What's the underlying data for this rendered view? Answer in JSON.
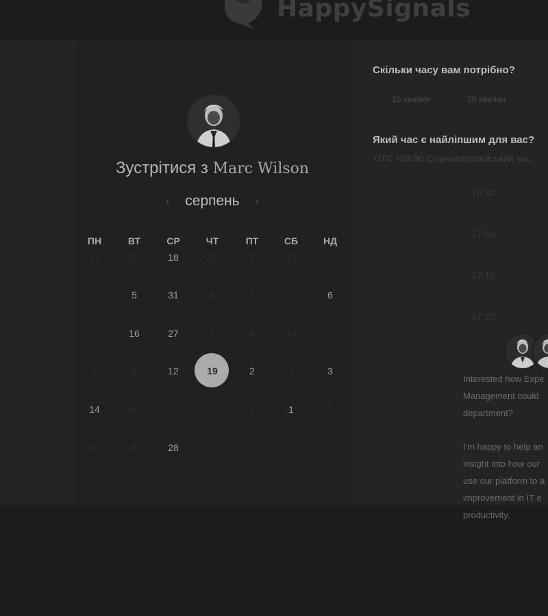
{
  "brand": {
    "name": "HappySignals",
    "logo_icon": "speech-bubble-heart-icon"
  },
  "host": {
    "heading_prefix": "Зустрітися з",
    "name": "Marc Wilson",
    "avatar_icon": "person-avatar-icon"
  },
  "calendar": {
    "month": "серпень",
    "prev_icon": "chevron-left-icon",
    "next_icon": "chevron-right-icon",
    "weekdays": [
      "ПН",
      "ВТ",
      "СР",
      "ЧТ",
      "ПТ",
      "СБ",
      "НД"
    ],
    "weeks": [
      [
        {
          "t": "11",
          "s": "m"
        },
        {
          "t": "20",
          "s": "m"
        },
        {
          "t": "18",
          "s": "a"
        },
        {
          "t": "27",
          "s": "m"
        },
        {
          "t": "7",
          "s": "m"
        },
        {
          "t": "23",
          "s": "m"
        },
        {
          "t": "7",
          "s": "m"
        }
      ],
      [
        {
          "t": "",
          "s": "m"
        },
        {
          "t": "5",
          "s": "a"
        },
        {
          "t": "31",
          "s": "a"
        },
        {
          "t": "4",
          "s": "m"
        },
        {
          "t": "1",
          "s": "m"
        },
        {
          "t": "1",
          "s": "m"
        },
        {
          "t": "6",
          "s": "a"
        }
      ],
      [
        {
          "t": "",
          "s": "m"
        },
        {
          "t": "16",
          "s": "a"
        },
        {
          "t": "27",
          "s": "a"
        },
        {
          "t": "1",
          "s": "m"
        },
        {
          "t": "4",
          "s": "m"
        },
        {
          "t": "10",
          "s": "m"
        },
        {
          "t": "1",
          "s": "m"
        }
      ],
      [
        {
          "t": "1",
          "s": "m"
        },
        {
          "t": "1",
          "s": "m"
        },
        {
          "t": "12",
          "s": "a"
        },
        {
          "t": "19",
          "s": "sel"
        },
        {
          "t": "2",
          "s": "a"
        },
        {
          "t": "1",
          "s": "m"
        },
        {
          "t": "3",
          "s": "a"
        }
      ],
      [
        {
          "t": "14",
          "s": "a"
        },
        {
          "t": "20",
          "s": "m"
        },
        {
          "t": "1",
          "s": "m"
        },
        {
          "t": "",
          "s": "m"
        },
        {
          "t": "1",
          "s": "m"
        },
        {
          "t": "1",
          "s": "a"
        },
        {
          "t": "1",
          "s": "m"
        }
      ],
      [
        {
          "t": "20",
          "s": "m"
        },
        {
          "t": "19",
          "s": "m"
        },
        {
          "t": "28",
          "s": "a"
        },
        {
          "t": "2",
          "s": "m"
        },
        {
          "t": "",
          "s": "m"
        },
        {
          "t": "1",
          "s": "m"
        },
        {
          "t": "1",
          "s": "m"
        }
      ]
    ]
  },
  "booking": {
    "duration_question": "Скільки часу вам потрібно?",
    "durations": [
      "15 хвилин",
      "30 хвилин"
    ],
    "time_question": "Який час є найліпшим для вас?",
    "timezone": "UTC +03:00 Східноєвропейський час",
    "slots": [
      "16:40",
      "17:00",
      "17:10",
      "17:20"
    ]
  },
  "team": {
    "avatar_icons": [
      "person-avatar-icon",
      "person-avatar-icon"
    ],
    "intro_lines": [
      "Interested how Expe",
      "Management could",
      "department?",
      "",
      "I'm happy to help an",
      "insight into how our",
      "use our platform to a",
      "improvement in IT e",
      "productivity."
    ]
  }
}
